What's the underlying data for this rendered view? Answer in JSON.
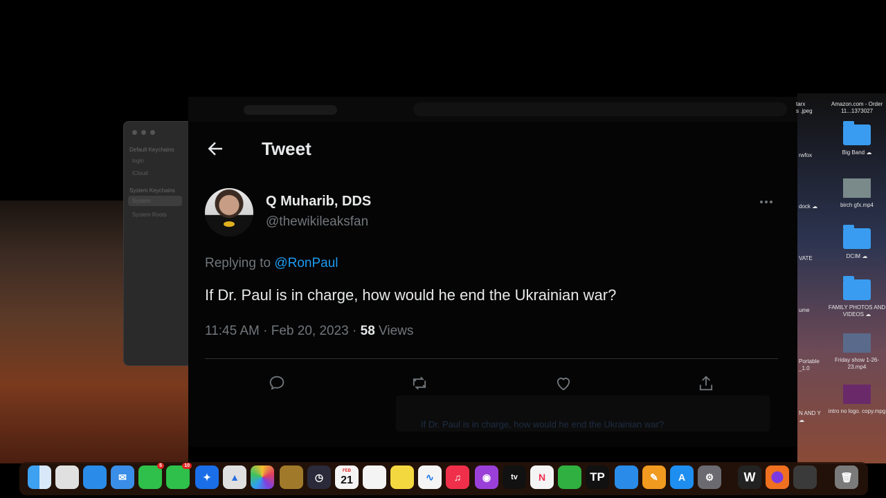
{
  "keychain": {
    "groups": [
      "Default Keychains",
      "System Keychains"
    ],
    "items": [
      "login",
      "iCloud",
      "System",
      "System Roots"
    ]
  },
  "tweet_page": {
    "title": "Tweet",
    "author": {
      "display_name": "Q Muharib, DDS",
      "handle": "@thewikileaksfan"
    },
    "replying_prefix": "Replying to",
    "replying_handle": "@RonPaul",
    "text": "If Dr. Paul is in charge, how would he end the Ukrainian war?",
    "timestamp": "11:45 AM · Feb 20, 2023 · ",
    "views_count": "58",
    "views_label": "Views",
    "reply_ghost_text": "If Dr. Paul is in charge, how would he end the Ukrainian war?",
    "accent_color": "#1d9bf0"
  },
  "desktop": {
    "items": [
      {
        "label": "Amazon.com - Order 11...1373027"
      },
      {
        "label": "Big Band ☁"
      },
      {
        "label": "birch gfx.mp4"
      },
      {
        "label": "DCIM ☁"
      },
      {
        "label": "FAMILY PHOTOS AND VIDEOS ☁"
      },
      {
        "label": "Friday show 1-26-23.mp4"
      },
      {
        "label": "intro no logo. copy.mpg"
      }
    ],
    "partial_labels": [
      "tarx",
      "s .jpeg",
      "rwfox",
      "dock ☁",
      "VATE",
      "ume",
      "Portable _1.0",
      "N AND Y ☁"
    ]
  },
  "dock": {
    "calendar_month": "FEB",
    "calendar_day": "21",
    "facetime_badge": "5",
    "messages_badge": "10",
    "tv_label": "tv",
    "tp_label": "TP"
  }
}
